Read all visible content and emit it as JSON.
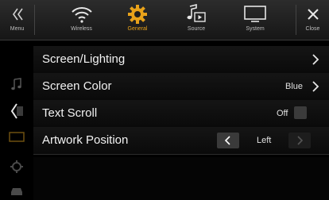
{
  "tabs": [
    {
      "label": "Menu",
      "icon": "double-chevron-left-icon"
    },
    {
      "label": "Wireless",
      "icon": "wifi-icon"
    },
    {
      "label": "General",
      "icon": "gear-icon"
    },
    {
      "label": "Source",
      "icon": "music-source-icon"
    },
    {
      "label": "System",
      "icon": "monitor-icon"
    },
    {
      "label": "Close",
      "icon": "close-icon"
    }
  ],
  "active_tab": "General",
  "accent_color": "#e8a21a",
  "sidebar_icons": [
    "music-icon",
    "back-chevron-icon",
    "screen-icon",
    "gear-icon",
    "car-icon"
  ],
  "rows": [
    {
      "label": "Screen/Lighting",
      "value": ""
    },
    {
      "label": "Screen Color",
      "value": "Blue"
    },
    {
      "label": "Text Scroll",
      "value": "Off"
    },
    {
      "label": "Artwork Position",
      "value": "Left"
    }
  ]
}
